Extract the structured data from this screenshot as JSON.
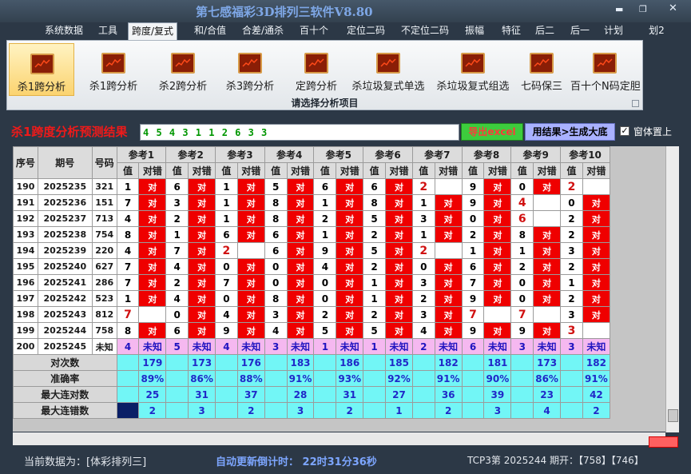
{
  "window": {
    "title": "第七感福彩3D排列三软件V8.80",
    "minimize": "▬",
    "restore": "❐",
    "close": "✕"
  },
  "menu": [
    "系统数据",
    "工具",
    "跨度/复式",
    "和/合值",
    "合差/通杀",
    "百十个",
    "定位二码",
    "不定位二码",
    "振幅",
    "特征",
    "后二",
    "后一",
    "计划",
    "划2"
  ],
  "menu_active": 2,
  "ribbon": {
    "items": [
      "杀1跨分析",
      "杀1跨分析",
      "杀2跨分析",
      "杀3跨分析",
      "定跨分析",
      "杀垃圾复式单选",
      "杀垃圾复式组选",
      "七码保三",
      "百十个N码定胆"
    ],
    "active": 0,
    "caption": "请选择分析项目"
  },
  "result": {
    "label": "杀1跨度分析预测结果",
    "value": "4 5 4 3 1 1 2 6 3 3",
    "excel_btn": "导出excel",
    "gen_btn": "用结果>生成大底",
    "top_checkbox": "窗体置上",
    "top_checked": true
  },
  "grid": {
    "hdr_seq": "序号",
    "hdr_period": "期号",
    "hdr_code": "号码",
    "hdr_val": "值",
    "hdr_result": "对错",
    "refs": [
      "参考1",
      "参考2",
      "参考3",
      "参考4",
      "参考5",
      "参考6",
      "参考7",
      "参考8",
      "参考9",
      "参考10"
    ],
    "hit": "对",
    "rows": [
      {
        "seq": "190",
        "period": "2025235",
        "code": "321",
        "cells": [
          [
            "1",
            "对"
          ],
          [
            "6",
            "对"
          ],
          [
            "1",
            "对"
          ],
          [
            "5",
            "对"
          ],
          [
            "6",
            "对"
          ],
          [
            "6",
            "对"
          ],
          [
            "2",
            ""
          ],
          [
            "9",
            "对"
          ],
          [
            "0",
            "对"
          ],
          [
            "2",
            ""
          ]
        ]
      },
      {
        "seq": "191",
        "period": "2025236",
        "code": "151",
        "cells": [
          [
            "7",
            "对"
          ],
          [
            "3",
            "对"
          ],
          [
            "1",
            "对"
          ],
          [
            "8",
            "对"
          ],
          [
            "1",
            "对"
          ],
          [
            "8",
            "对"
          ],
          [
            "1",
            "对"
          ],
          [
            "9",
            "对"
          ],
          [
            "4",
            ""
          ],
          [
            "0",
            "对"
          ]
        ]
      },
      {
        "seq": "192",
        "period": "2025237",
        "code": "713",
        "cells": [
          [
            "4",
            "对"
          ],
          [
            "2",
            "对"
          ],
          [
            "1",
            "对"
          ],
          [
            "8",
            "对"
          ],
          [
            "2",
            "对"
          ],
          [
            "5",
            "对"
          ],
          [
            "3",
            "对"
          ],
          [
            "0",
            "对"
          ],
          [
            "6",
            ""
          ],
          [
            "2",
            "对"
          ]
        ]
      },
      {
        "seq": "193",
        "period": "2025238",
        "code": "754",
        "cells": [
          [
            "8",
            "对"
          ],
          [
            "1",
            "对"
          ],
          [
            "6",
            "对"
          ],
          [
            "6",
            "对"
          ],
          [
            "1",
            "对"
          ],
          [
            "2",
            "对"
          ],
          [
            "1",
            "对"
          ],
          [
            "2",
            "对"
          ],
          [
            "8",
            "对"
          ],
          [
            "2",
            "对"
          ]
        ]
      },
      {
        "seq": "194",
        "period": "2025239",
        "code": "220",
        "cells": [
          [
            "4",
            "对"
          ],
          [
            "7",
            "对"
          ],
          [
            "2",
            ""
          ],
          [
            "6",
            "对"
          ],
          [
            "9",
            "对"
          ],
          [
            "5",
            "对"
          ],
          [
            "2",
            ""
          ],
          [
            "1",
            "对"
          ],
          [
            "1",
            "对"
          ],
          [
            "3",
            "对"
          ]
        ]
      },
      {
        "seq": "195",
        "period": "2025240",
        "code": "627",
        "cells": [
          [
            "7",
            "对"
          ],
          [
            "4",
            "对"
          ],
          [
            "0",
            "对"
          ],
          [
            "0",
            "对"
          ],
          [
            "4",
            "对"
          ],
          [
            "2",
            "对"
          ],
          [
            "0",
            "对"
          ],
          [
            "6",
            "对"
          ],
          [
            "2",
            "对"
          ],
          [
            "2",
            "对"
          ]
        ]
      },
      {
        "seq": "196",
        "period": "2025241",
        "code": "286",
        "cells": [
          [
            "7",
            "对"
          ],
          [
            "2",
            "对"
          ],
          [
            "7",
            "对"
          ],
          [
            "0",
            "对"
          ],
          [
            "0",
            "对"
          ],
          [
            "1",
            "对"
          ],
          [
            "3",
            "对"
          ],
          [
            "7",
            "对"
          ],
          [
            "0",
            "对"
          ],
          [
            "1",
            "对"
          ]
        ]
      },
      {
        "seq": "197",
        "period": "2025242",
        "code": "523",
        "cells": [
          [
            "1",
            "对"
          ],
          [
            "4",
            "对"
          ],
          [
            "0",
            "对"
          ],
          [
            "8",
            "对"
          ],
          [
            "0",
            "对"
          ],
          [
            "1",
            "对"
          ],
          [
            "2",
            "对"
          ],
          [
            "9",
            "对"
          ],
          [
            "0",
            "对"
          ],
          [
            "2",
            "对"
          ]
        ]
      },
      {
        "seq": "198",
        "period": "2025243",
        "code": "812",
        "cells": [
          [
            "7",
            ""
          ],
          [
            "0",
            "对"
          ],
          [
            "4",
            "对"
          ],
          [
            "3",
            "对"
          ],
          [
            "2",
            "对"
          ],
          [
            "2",
            "对"
          ],
          [
            "3",
            "对"
          ],
          [
            "7",
            ""
          ],
          [
            "7",
            ""
          ],
          [
            "3",
            "对"
          ]
        ]
      },
      {
        "seq": "199",
        "period": "2025244",
        "code": "758",
        "cells": [
          [
            "8",
            "对"
          ],
          [
            "6",
            "对"
          ],
          [
            "9",
            "对"
          ],
          [
            "4",
            "对"
          ],
          [
            "5",
            "对"
          ],
          [
            "5",
            "对"
          ],
          [
            "4",
            "对"
          ],
          [
            "9",
            "对"
          ],
          [
            "9",
            "对"
          ],
          [
            "3",
            ""
          ]
        ]
      }
    ],
    "next_row": {
      "seq": "200",
      "period": "2025245",
      "code": "未知",
      "unknown": "未知",
      "values": [
        "4",
        "5",
        "4",
        "3",
        "1",
        "1",
        "2",
        "6",
        "3",
        "3"
      ]
    },
    "summary": {
      "count_label": "对次数",
      "count": [
        "179",
        "173",
        "176",
        "183",
        "186",
        "185",
        "182",
        "181",
        "173",
        "182"
      ],
      "rate_label": "准确率",
      "rate": [
        "89%",
        "86%",
        "88%",
        "91%",
        "93%",
        "92%",
        "91%",
        "90%",
        "86%",
        "91%"
      ],
      "maxhit_label": "最大连对数",
      "maxhit": [
        "25",
        "31",
        "37",
        "28",
        "31",
        "27",
        "36",
        "39",
        "23",
        "42"
      ],
      "maxmiss_label": "最大连错数",
      "maxmiss": [
        "2",
        "3",
        "2",
        "3",
        "2",
        "1",
        "2",
        "3",
        "4",
        "2"
      ]
    }
  },
  "status": {
    "data_source": "当前数据为：[体彩排列三]",
    "countdown": "自动更新倒计时： 22时31分36秒",
    "tcp": "TCP3第 2025244 期开：【758】【746】"
  }
}
